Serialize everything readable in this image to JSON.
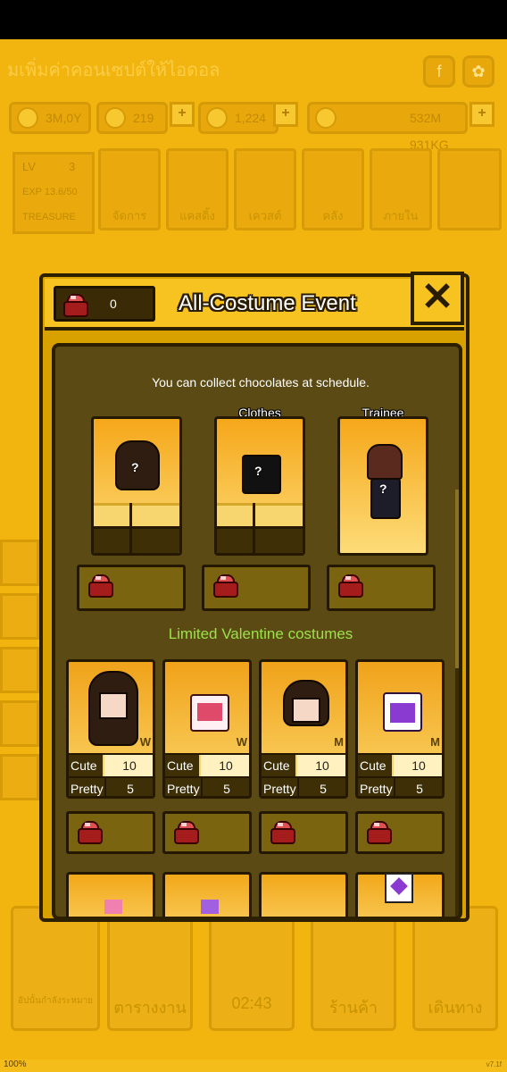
{
  "statusbar": {},
  "background": {
    "title": "มเพิ่มค่าคอนเซปต์ให้ไอดอล",
    "stats": [
      "3M,0Y",
      "219",
      "1,224",
      "532M 931KG"
    ],
    "level": {
      "lv_label": "LV",
      "lv_value": "3",
      "exp": "EXP 13.6/50",
      "treasure": "TREASURE"
    },
    "tiles": [
      "จัดการ",
      "แคสติ้ง",
      "เควสต์",
      "คลัง",
      "ภายใน"
    ],
    "bottom_nav": [
      "ตารางงาน",
      "02:43",
      "ร้านค้า",
      "เดินทาง"
    ],
    "bottom_left_caption": "อัปนั้นกำลังระหมาย",
    "zoom": "100%",
    "version": "v7.1f"
  },
  "modal": {
    "title": "All-Costume Event",
    "chocolate_count": "0",
    "close_label": "✕",
    "info_text": "You can collect chocolates at schedule.",
    "top_cards": [
      {
        "label": "",
        "mystery": "?"
      },
      {
        "label": "Clothes",
        "mystery": "?"
      },
      {
        "label": "Trainee",
        "mystery": "?"
      }
    ],
    "section_title": "Limited Valentine costumes",
    "valentine_cards": [
      {
        "sex": "W",
        "stat1_name": "Cute",
        "stat1_value": "10",
        "stat2_name": "Pretty",
        "stat2_value": "5"
      },
      {
        "sex": "W",
        "stat1_name": "Cute",
        "stat1_value": "10",
        "stat2_name": "Pretty",
        "stat2_value": "5"
      },
      {
        "sex": "M",
        "stat1_name": "Cute",
        "stat1_value": "10",
        "stat2_name": "Pretty",
        "stat2_value": "5"
      },
      {
        "sex": "M",
        "stat1_name": "Cute",
        "stat1_value": "10",
        "stat2_name": "Pretty",
        "stat2_value": "5"
      }
    ]
  },
  "colors": {
    "game_bg": "#f2b40f",
    "panel_bg": "#5b4a14",
    "section_green": "#9be24a",
    "chocolate_red": "#a51c1c"
  }
}
